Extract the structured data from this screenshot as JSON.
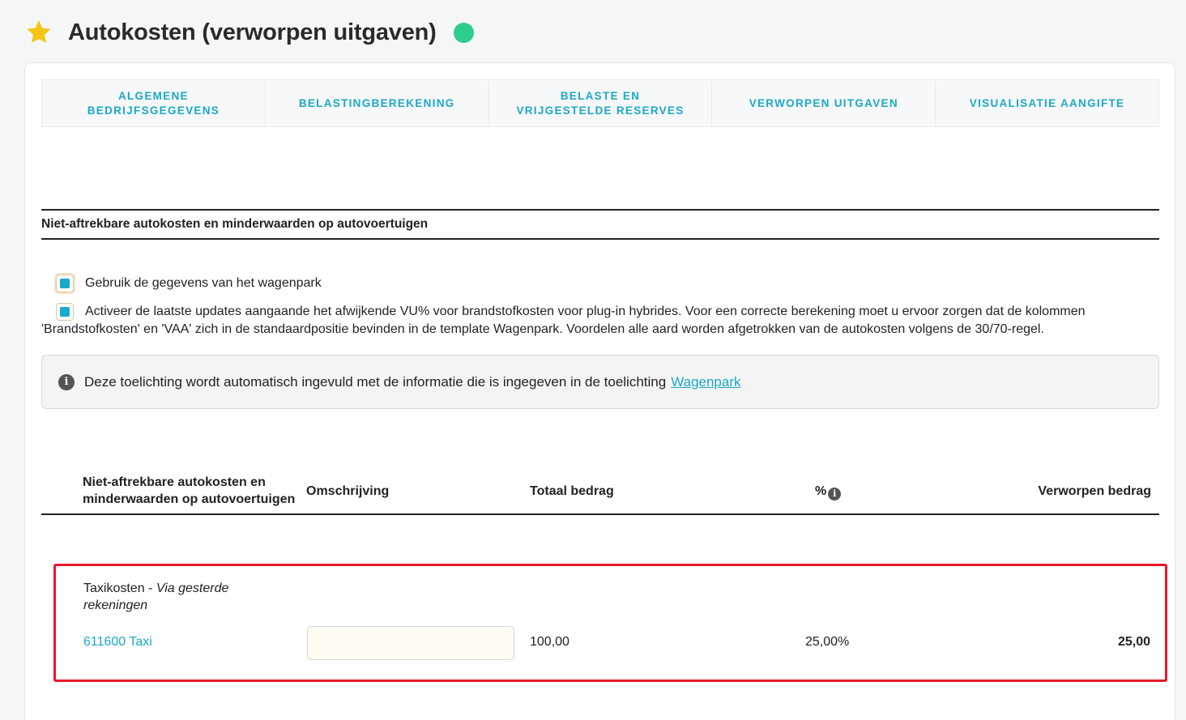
{
  "header": {
    "title": "Autokosten (verworpen uitgaven)",
    "star_color": "#f5c518",
    "status_color": "#2ecc8f"
  },
  "tabs": [
    {
      "label": "ALGEMENE BEDRIJFSGEGEVENS"
    },
    {
      "label": "BELASTINGBEREKENING"
    },
    {
      "label": "BELASTE EN VRIJGESTELDE RESERVES"
    },
    {
      "label": "VERWORPEN UITGAVEN"
    },
    {
      "label": "VISUALISATIE AANGIFTE"
    }
  ],
  "section": {
    "title": "Niet-aftrekbare autokosten en minderwaarden op autovoertuigen"
  },
  "options": {
    "use_fleet_label": "Gebruik de gegevens van het wagenpark",
    "use_fleet_checked": true,
    "hybrid_text": "Activeer de laatste updates aangaande het afwijkende VU% voor brandstofkosten voor plug-in hybrides. Voor een correcte berekening moet u ervoor zorgen dat de kolommen 'Brandstofkosten' en 'VAA' zich in de standaardpositie bevinden in de template Wagenpark. Voordelen alle aard worden afgetrokken van de autokosten volgens de 30/70-regel.",
    "hybrid_checked": true,
    "check_color": "#1aa9c7"
  },
  "info": {
    "text": "Deze toelichting wordt automatisch ingevuld met de informatie die is ingegeven in de toelichting",
    "link": "Wagenpark"
  },
  "table": {
    "columns": {
      "category": "Niet-aftrekbare autokosten en minderwaarden op autovoertuigen",
      "description": "Omschrijving",
      "total": "Totaal bedrag",
      "percent": "%",
      "rejected": "Verworpen bedrag"
    },
    "row": {
      "label": "Taxikosten - ",
      "label_italic": "Via gesterde rekeningen",
      "account": "611600 Taxi",
      "description_value": "",
      "total": "100,00",
      "percent": "25,00%",
      "rejected": "25,00"
    }
  }
}
